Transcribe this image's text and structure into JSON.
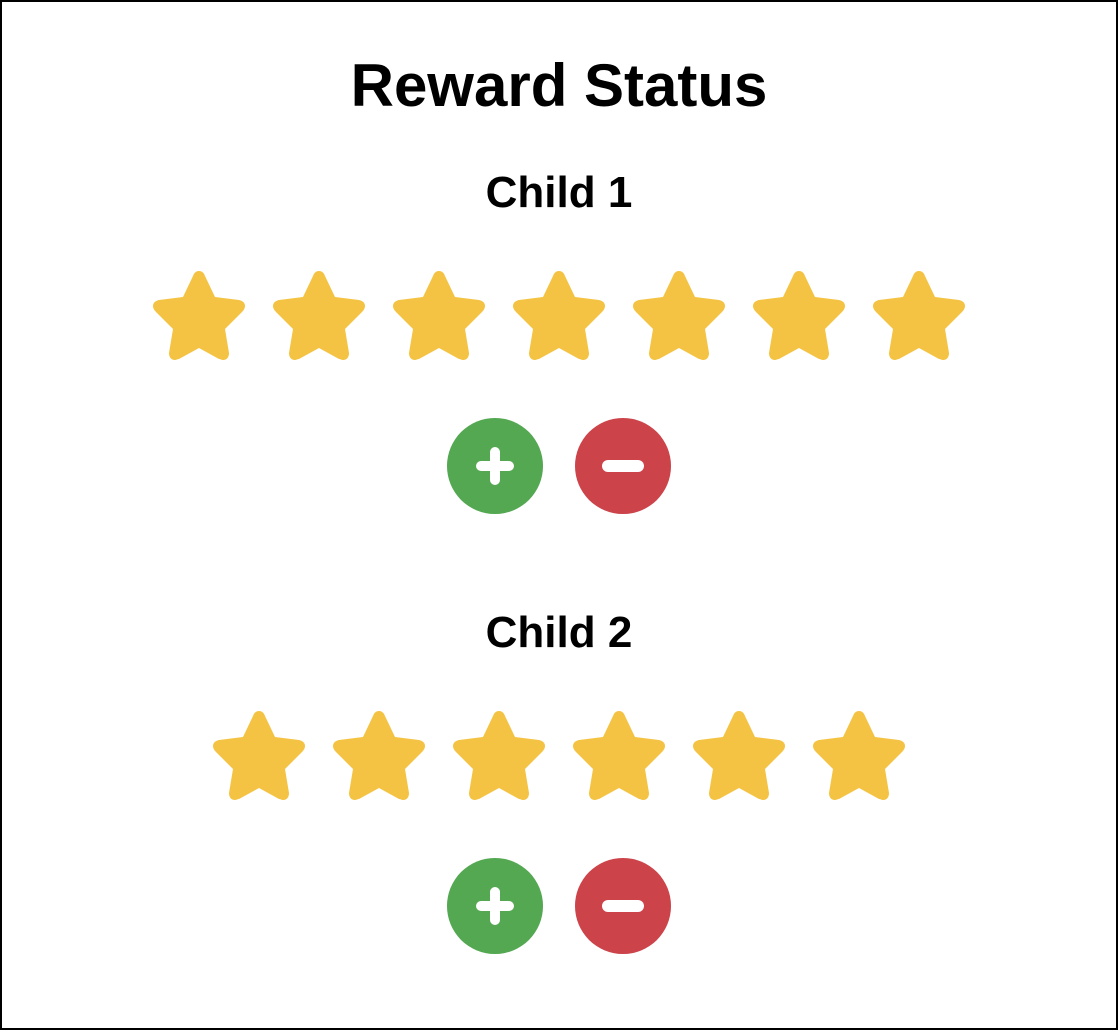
{
  "page": {
    "title": "Reward Status"
  },
  "colors": {
    "star": "#F4C343",
    "add": "#53A851",
    "remove": "#CC434A",
    "border": "#000000"
  },
  "icons": {
    "star": "star-icon",
    "add": "plus-icon",
    "remove": "minus-icon"
  },
  "children": [
    {
      "name": "Child 1",
      "stars": 7
    },
    {
      "name": "Child 2",
      "stars": 6
    }
  ]
}
